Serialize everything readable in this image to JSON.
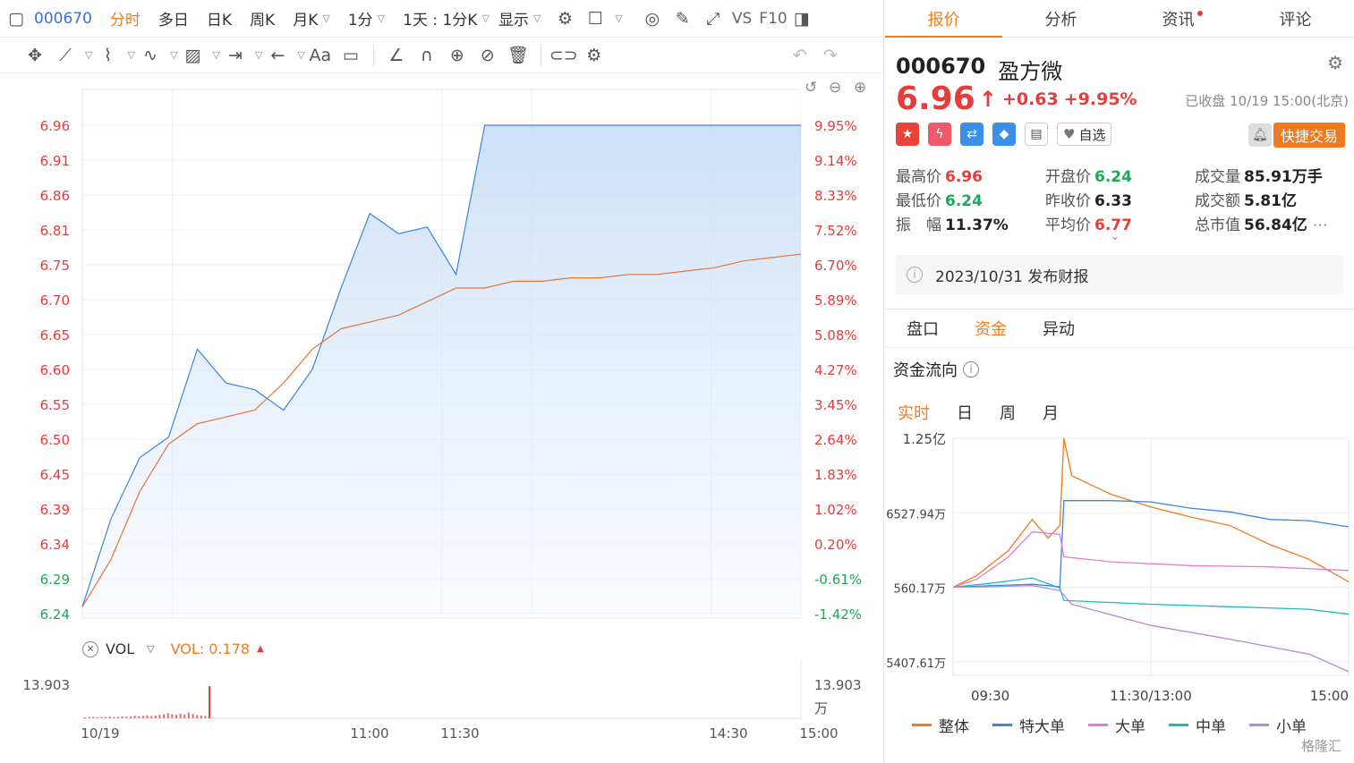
{
  "toolbar": {
    "code": "000670",
    "items": [
      "分时",
      "多日",
      "日K",
      "周K",
      "月K",
      "1分",
      "1天 : 1分K",
      "显示"
    ],
    "right_text": [
      "VS",
      "F10"
    ]
  },
  "chart_header": {
    "vol_label": "VOL",
    "vol_value": "VOL: 0.178"
  },
  "colors": {
    "up": "#e83b3b",
    "down": "#1aaa55",
    "accent": "#f07a1f",
    "price_line": "#3b86e0",
    "avg_line": "#e2743a"
  },
  "chart_data": [
    {
      "type": "line",
      "title": "",
      "x": [
        "09:30",
        "09:35",
        "09:40",
        "09:45",
        "09:50",
        "09:55",
        "10:00",
        "10:05",
        "10:10",
        "10:15",
        "10:20",
        "10:25",
        "10:30",
        "10:35",
        "10:40",
        "10:45",
        "10:50",
        "10:55",
        "11:00",
        "11:15",
        "11:30",
        "13:00",
        "13:30",
        "14:00",
        "14:30",
        "15:00"
      ],
      "series": [
        {
          "values": [
            6.25,
            6.38,
            6.47,
            6.5,
            6.63,
            6.58,
            6.57,
            6.54,
            6.6,
            6.72,
            6.83,
            6.8,
            6.81,
            6.74,
            6.96,
            6.96,
            6.96,
            6.96,
            6.96,
            6.96,
            6.96,
            6.96,
            6.96,
            6.96,
            6.96,
            6.96
          ]
        },
        {
          "values": [
            6.25,
            6.32,
            6.42,
            6.49,
            6.52,
            6.53,
            6.54,
            6.58,
            6.63,
            6.66,
            6.67,
            6.68,
            6.7,
            6.72,
            6.72,
            6.73,
            6.73,
            6.735,
            6.735,
            6.74,
            6.74,
            6.745,
            6.75,
            6.76,
            6.765,
            6.77
          ]
        }
      ],
      "x_tick_labels": [
        "10/19",
        "11:00",
        "11:30",
        "14:30",
        "15:00"
      ],
      "y_left_ticks": [
        "6.96",
        "6.91",
        "6.86",
        "6.81",
        "6.75",
        "6.70",
        "6.65",
        "6.60",
        "6.55",
        "6.50",
        "6.45",
        "6.39",
        "6.34",
        "6.29",
        "6.24"
      ],
      "y_right_ticks": [
        "9.95%",
        "9.14%",
        "8.33%",
        "7.52%",
        "6.70%",
        "5.89%",
        "5.08%",
        "4.27%",
        "3.45%",
        "2.64%",
        "1.83%",
        "1.02%",
        "0.20%",
        "-0.61%",
        "-1.42%"
      ],
      "ylim": [
        6.24,
        6.96
      ]
    },
    {
      "type": "bar",
      "title": "",
      "vol_axis_left": "13.903",
      "vol_axis_right": "13.903",
      "vol_unit": "万",
      "values": [
        0.4,
        0.5,
        0.6,
        0.4,
        0.5,
        0.6,
        0.7,
        0.5,
        0.6,
        0.8,
        0.7,
        0.9,
        1.1,
        0.9,
        1.0,
        1.3,
        1.0,
        1.2,
        1.5,
        1.8,
        2.2,
        1.8,
        1.5,
        2.0,
        1.7,
        2.5,
        1.9,
        1.4,
        1.2,
        1.0,
        13.903,
        0.1,
        0.05
      ],
      "ylim": [
        0,
        13.903
      ]
    },
    {
      "type": "line",
      "title": "",
      "x_tick_labels": [
        "09:30",
        "11:30/13:00",
        "15:00"
      ],
      "y_tick_labels": [
        "1.25亿",
        "6527.94万",
        "560.17万",
        "-5407.61万"
      ],
      "series": [
        {
          "name": "整体",
          "color": "#f07a1f",
          "points": [
            [
              0,
              560
            ],
            [
              0.06,
              1500
            ],
            [
              0.14,
              3500
            ],
            [
              0.2,
              6000
            ],
            [
              0.24,
              4500
            ],
            [
              0.27,
              5500
            ],
            [
              0.28,
              12500
            ],
            [
              0.3,
              9500
            ],
            [
              0.4,
              8000
            ],
            [
              0.5,
              7000
            ],
            [
              0.6,
              6200
            ],
            [
              0.7,
              5500
            ],
            [
              0.8,
              4000
            ],
            [
              0.9,
              2800
            ],
            [
              1.0,
              1000
            ]
          ]
        },
        {
          "name": "特大单",
          "color": "#3b86e0",
          "points": [
            [
              0,
              560
            ],
            [
              0.1,
              700
            ],
            [
              0.2,
              800
            ],
            [
              0.27,
              600
            ],
            [
              0.28,
              7500
            ],
            [
              0.4,
              7500
            ],
            [
              0.5,
              7400
            ],
            [
              0.6,
              6900
            ],
            [
              0.7,
              6600
            ],
            [
              0.8,
              6000
            ],
            [
              0.9,
              5900
            ],
            [
              1.0,
              5400
            ]
          ]
        },
        {
          "name": "大单",
          "color": "#e77bd4",
          "points": [
            [
              0,
              560
            ],
            [
              0.06,
              1200
            ],
            [
              0.14,
              3000
            ],
            [
              0.2,
              5000
            ],
            [
              0.27,
              4800
            ],
            [
              0.28,
              3000
            ],
            [
              0.4,
              2600
            ],
            [
              0.6,
              2300
            ],
            [
              0.8,
              2200
            ],
            [
              1.0,
              1900
            ]
          ]
        },
        {
          "name": "中单",
          "color": "#1fb8c4",
          "points": [
            [
              0,
              560
            ],
            [
              0.1,
              900
            ],
            [
              0.2,
              1300
            ],
            [
              0.27,
              500
            ],
            [
              0.28,
              -500
            ],
            [
              0.5,
              -800
            ],
            [
              0.7,
              -1000
            ],
            [
              0.9,
              -1200
            ],
            [
              1.0,
              -1600
            ]
          ]
        },
        {
          "name": "小单",
          "color": "#b58ad8",
          "points": [
            [
              0,
              560
            ],
            [
              0.1,
              600
            ],
            [
              0.2,
              700
            ],
            [
              0.27,
              300
            ],
            [
              0.3,
              -800
            ],
            [
              0.5,
              -2500
            ],
            [
              0.7,
              -3600
            ],
            [
              0.9,
              -4800
            ],
            [
              1.0,
              -6200
            ]
          ]
        }
      ],
      "ylim": [
        -6500,
        12500
      ]
    }
  ],
  "quote": {
    "tabs": [
      "报价",
      "分析",
      "资讯",
      "评论"
    ],
    "code": "000670",
    "name": "盈方微",
    "price": "6.96",
    "arrow": "↑",
    "change": "+0.63",
    "pct": "+9.95%",
    "status": "已收盘 10/19 15:00(北京)",
    "zixuan": "自选",
    "trade_btn": "快捷交易",
    "stats": [
      {
        "label": "最高价",
        "value": "6.96",
        "color": "red"
      },
      {
        "label": "开盘价",
        "value": "6.24",
        "color": "green"
      },
      {
        "label": "成交量",
        "value": "85.91万手",
        "color": "dark"
      },
      {
        "label": "最低价",
        "value": "6.24",
        "color": "green"
      },
      {
        "label": "昨收价",
        "value": "6.33",
        "color": "dark"
      },
      {
        "label": "成交额",
        "value": "5.81亿",
        "color": "dark"
      },
      {
        "label": "振　幅",
        "value": "11.37%",
        "color": "dark"
      },
      {
        "label": "平均价",
        "value": "6.77",
        "color": "red"
      },
      {
        "label": "总市值",
        "value": "56.84亿",
        "color": "dark"
      }
    ],
    "news": "2023/10/31  发布财报",
    "subtabs": [
      "盘口",
      "资金",
      "异动"
    ],
    "flow_title": "资金流向",
    "periods": [
      "实时",
      "日",
      "周",
      "月"
    ],
    "watermark": "格隆汇"
  }
}
